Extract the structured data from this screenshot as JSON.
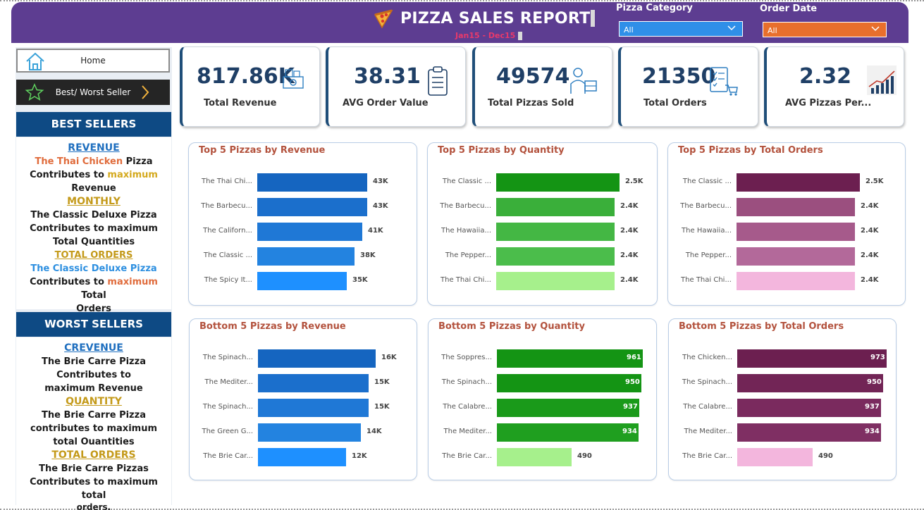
{
  "header": {
    "title": "PIZZA SALES REPORT",
    "subtitle": "Jan15 - Dec15",
    "filters": [
      {
        "label": "Pizza Category",
        "value": "All",
        "color": "#2f8fe8"
      },
      {
        "label": "Order Date",
        "value": "All",
        "color": "#e86f2c"
      }
    ]
  },
  "nav": {
    "home_label": "Home",
    "best_worst_label": "Best/ Worst Seller"
  },
  "best_sellers": {
    "heading": "BEST SELLERS",
    "revenue_heading": "REVENUE",
    "revenue_text": {
      "pizza": "The Thai Chicken",
      "pizza_tail": " Pizza",
      "line2_a": "Contributes to ",
      "line2_b": "maximum",
      "line3": "Revenue"
    },
    "monthly_heading": "MONTHLY",
    "monthly_text": "The Classic Deluxe Pizza Contributes to maximum Total Quantities",
    "orders_heading": "TOTAL ORDERS",
    "orders_text": {
      "pizza": "The Classic Deluxe Pizza",
      "line2_a": "Contributes to ",
      "line2_b": "maximum",
      "line2_c": " Total",
      "line3": "Orders"
    }
  },
  "worst_sellers": {
    "heading": "WORST SELLERS",
    "revenue_heading": "CREVENUE",
    "revenue_text": "The Brie Carre Pizza Contributes to maximum Revenue",
    "quantity_heading": "QUANTITY",
    "quantity_text": "The Brie Carre Pizza contributes to maximum total Ouantities",
    "orders_heading": "TOTAL ORDERS",
    "orders_text_a": "The Brie Carre Pizzas",
    "orders_text_b": "Contributes to maximum total",
    "orders_text_c": "orders."
  },
  "kpis": [
    {
      "value": "817.86K",
      "label": "Total Revenue",
      "icon": "money-icon"
    },
    {
      "value": "38.31",
      "label": "AVG Order Value",
      "icon": "clipboard-icon"
    },
    {
      "value": "49574",
      "label": "Total Pizzas Sold",
      "icon": "delivery-icon"
    },
    {
      "value": "21350",
      "label": "Total Orders",
      "icon": "checklist-cart-icon"
    },
    {
      "value": "2.32",
      "label": "AVG Pizzas Per...",
      "icon": "trend-chart-icon"
    }
  ],
  "chart_data": [
    {
      "type": "bar",
      "title": "Top 5 Pizzas by Revenue",
      "categories": [
        "The Thai Chi...",
        "The Barbecu...",
        "The Californ...",
        "The Classic ...",
        "The Spicy It..."
      ],
      "values": [
        43,
        43,
        41,
        38,
        35
      ],
      "labels": [
        "43K",
        "43K",
        "41K",
        "38K",
        "35K"
      ],
      "colors": [
        "#1565c0",
        "#1b6fcc",
        "#1f78d6",
        "#2383e0",
        "#1e90ff"
      ]
    },
    {
      "type": "bar",
      "title": "Top 5 Pizzas by Quantity",
      "categories": [
        "The Classic ...",
        "The Barbecu...",
        "The Hawaiia...",
        "The Pepper...",
        "The Thai Chi..."
      ],
      "values": [
        2.5,
        2.4,
        2.4,
        2.4,
        2.4
      ],
      "labels": [
        "2.5K",
        "2.4K",
        "2.4K",
        "2.4K",
        "2.4K"
      ],
      "colors": [
        "#149414",
        "#3aaf3a",
        "#44b744",
        "#4bbd4b",
        "#a6f08c"
      ]
    },
    {
      "type": "bar",
      "title": "Top 5 Pizzas by Total Orders",
      "categories": [
        "The Classic ...",
        "The Barbecu...",
        "The Hawaiia...",
        "The Pepper...",
        "The Thai Chi..."
      ],
      "values": [
        2.5,
        2.4,
        2.4,
        2.4,
        2.4
      ],
      "labels": [
        "2.5K",
        "2.4K",
        "2.4K",
        "2.4K",
        "2.4K"
      ],
      "colors": [
        "#6c1f50",
        "#9b4f7f",
        "#a65a8b",
        "#b3699a",
        "#f3b6dd"
      ]
    },
    {
      "type": "bar",
      "title": "Bottom 5 Pizzas by Revenue",
      "categories": [
        "The Spinach...",
        "The Mediter...",
        "The Spinach...",
        "The Green G...",
        "The Brie Car..."
      ],
      "values": [
        16,
        15,
        15,
        14,
        12
      ],
      "labels": [
        "16K",
        "15K",
        "15K",
        "14K",
        "12K"
      ],
      "colors": [
        "#1565c0",
        "#1b6fcc",
        "#1f78d6",
        "#2383e0",
        "#1e90ff"
      ]
    },
    {
      "type": "bar",
      "title": "Bottom 5 Pizzas by Quantity",
      "categories": [
        "The Soppres...",
        "The Spinach...",
        "The Calabre...",
        "The Mediter...",
        "The Brie Car..."
      ],
      "values": [
        961,
        950,
        937,
        934,
        490
      ],
      "labels": [
        "961",
        "950",
        "937",
        "934",
        "490"
      ],
      "colors": [
        "#149414",
        "#149414",
        "#1a9a1a",
        "#1f9f1f",
        "#a6f08c"
      ]
    },
    {
      "type": "bar",
      "title": "Bottom 5 Pizzas by Total Orders",
      "categories": [
        "The Chicken...",
        "The Spinach...",
        "The Calabre...",
        "The Mediter...",
        "The Brie Car..."
      ],
      "values": [
        973,
        950,
        937,
        934,
        490
      ],
      "labels": [
        "973",
        "950",
        "937",
        "934",
        "490"
      ],
      "colors": [
        "#6c1f50",
        "#722556",
        "#7a2a5e",
        "#7f2f63",
        "#f3b6dd"
      ]
    }
  ]
}
